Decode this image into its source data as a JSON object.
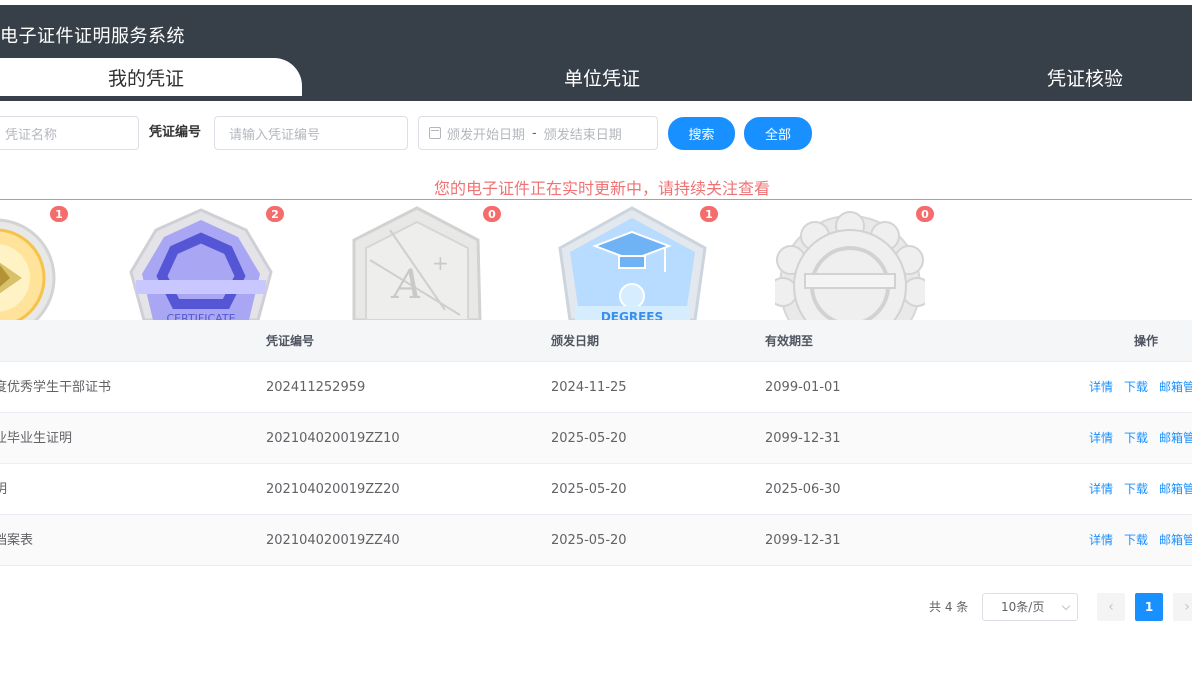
{
  "app": {
    "title": "电子证件证明服务系统"
  },
  "tabs": [
    {
      "label": "我的凭证"
    },
    {
      "label": "单位凭证"
    },
    {
      "label": "凭证核验"
    }
  ],
  "search": {
    "name_placeholder": "凭证名称",
    "code_label": "凭证编号",
    "code_placeholder": "请输入凭证编号",
    "start_placeholder": "颁发开始日期",
    "range_separator": "-",
    "end_placeholder": "颁发结束日期",
    "search_label": "搜索",
    "all_label": "全部"
  },
  "notice": "您的电子证件正在实时更新中，请持续关注查看",
  "badges": [
    {
      "icon": "medal-gold-icon",
      "count": "1"
    },
    {
      "icon": "certificate-badge-icon",
      "count": "2"
    },
    {
      "icon": "a-plus-badge-icon",
      "count": "0"
    },
    {
      "icon": "degree-badge-icon",
      "count": "1"
    },
    {
      "icon": "seal-badge-icon",
      "count": "0"
    }
  ],
  "table": {
    "headers": {
      "code": "凭证编号",
      "issue": "颁发日期",
      "expire": "有效期至",
      "ops": "操作"
    },
    "rows": [
      {
        "name": "度优秀学生干部证书",
        "code": "202411252959",
        "issue": "2024-11-25",
        "expire": "2099-01-01"
      },
      {
        "name": "业毕业生证明",
        "code": "202104020019ZZ10",
        "issue": "2025-05-20",
        "expire": "2099-12-31"
      },
      {
        "name": "明",
        "code": "202104020019ZZ20",
        "issue": "2025-05-20",
        "expire": "2025-06-30"
      },
      {
        "name": "档案表",
        "code": "202104020019ZZ40",
        "issue": "2025-05-20",
        "expire": "2099-12-31"
      }
    ],
    "ops": {
      "detail": "详情",
      "download": "下载",
      "mailbox": "邮箱管"
    }
  },
  "pagination": {
    "total": "共 4 条",
    "page_size": "10条/页",
    "current": "1",
    "prev": "‹",
    "next": "›"
  }
}
